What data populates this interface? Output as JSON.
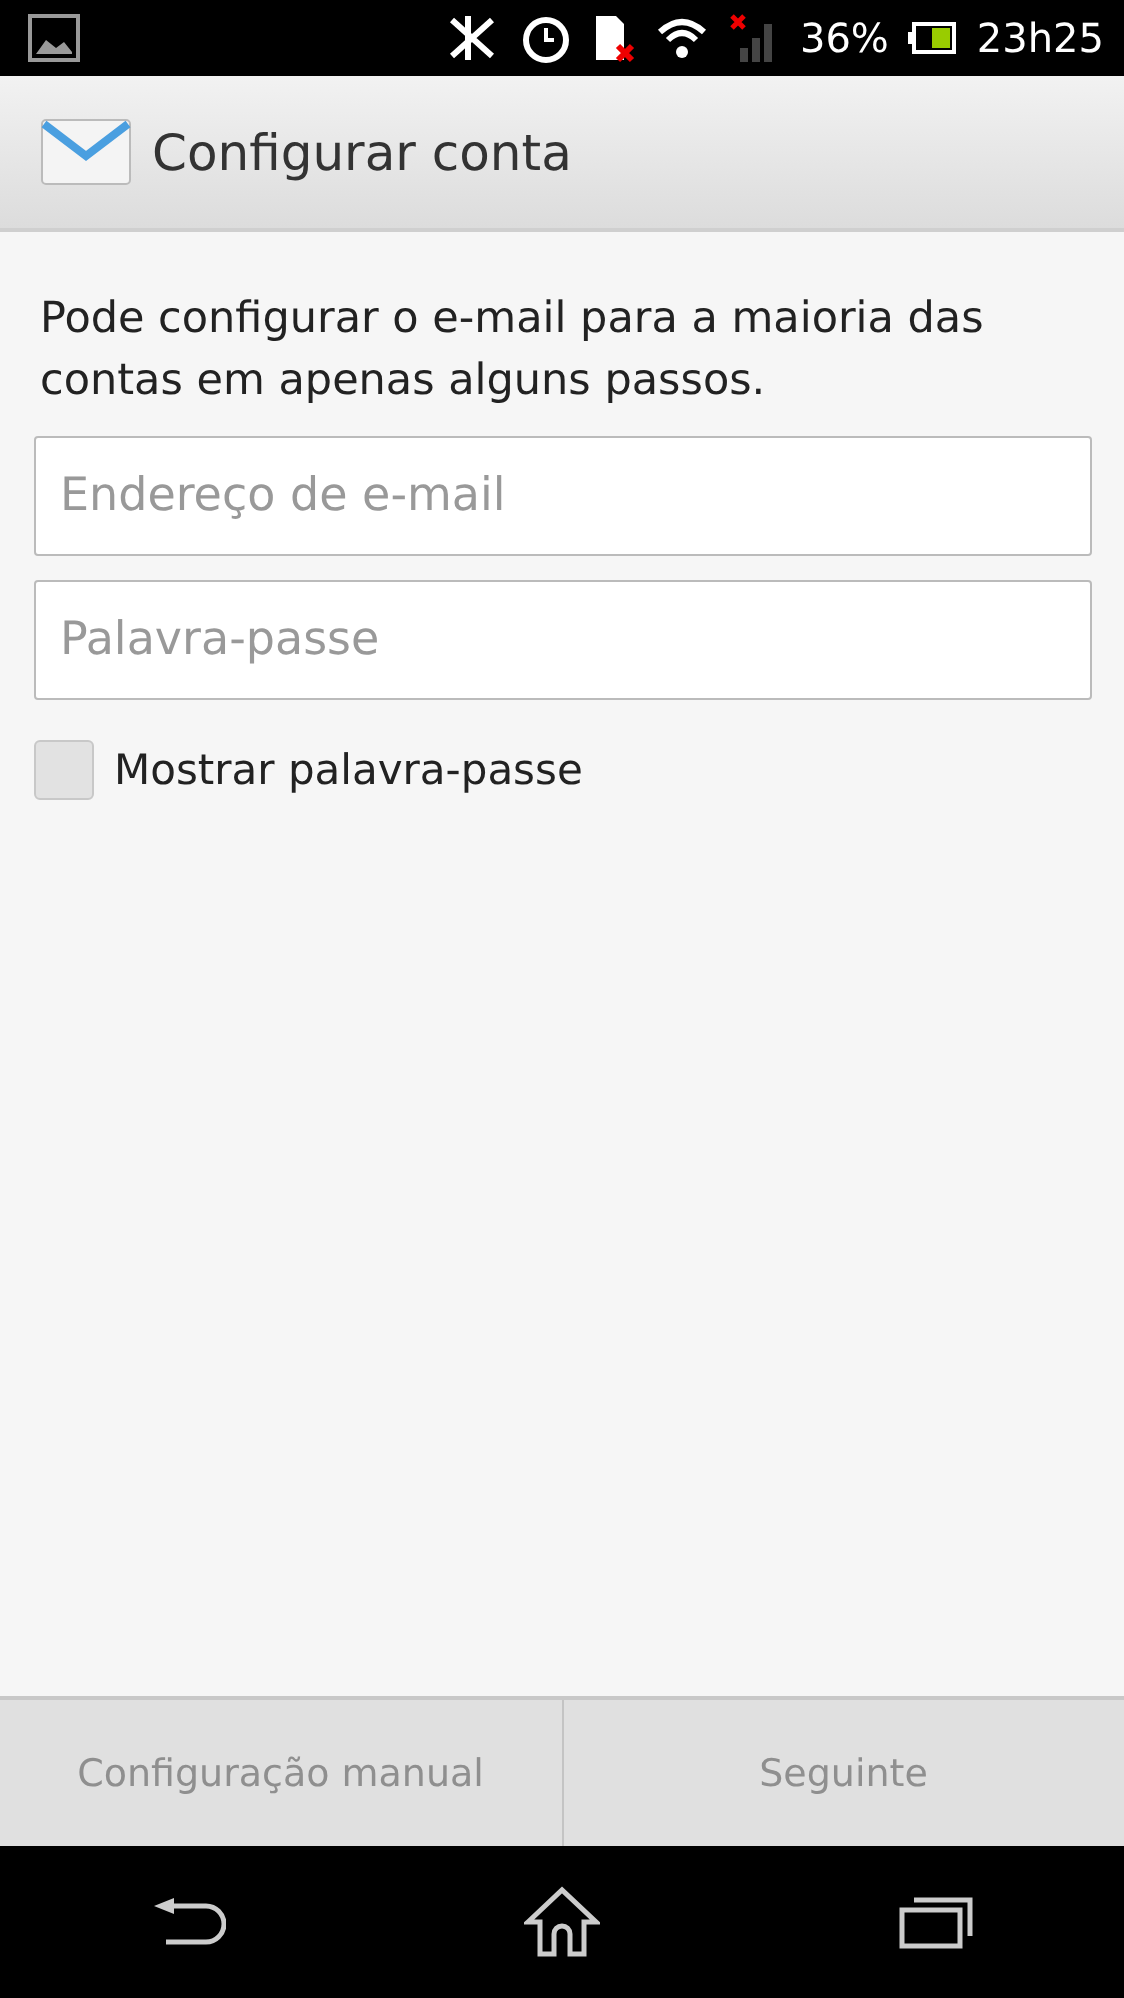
{
  "status_bar": {
    "battery": "36%",
    "time": "23h25"
  },
  "action_bar": {
    "title": "Configurar conta"
  },
  "intro": "Pode configurar o e-mail para a maioria das contas em apenas alguns passos.",
  "fields": [
    {
      "placeholder": "Endereço de e-mail"
    },
    {
      "placeholder": "Palavra-passe"
    }
  ],
  "show_password": {
    "label": "Mostrar palavra-passe",
    "checked": false
  },
  "buttons": [
    {
      "label": "Configuração manual",
      "disabled": true
    },
    {
      "label": "Seguinte",
      "disabled": true
    }
  ]
}
